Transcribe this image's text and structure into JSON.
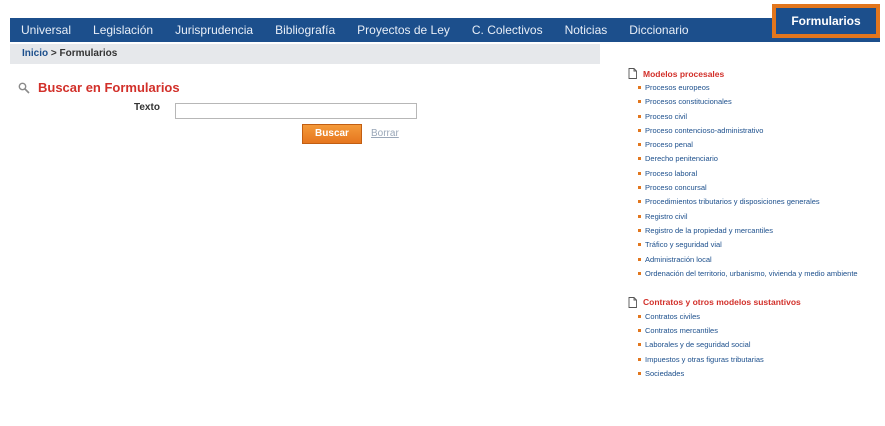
{
  "nav": {
    "items": [
      {
        "label": "Universal"
      },
      {
        "label": "Legislación"
      },
      {
        "label": "Jurisprudencia"
      },
      {
        "label": "Bibliografía"
      },
      {
        "label": "Proyectos de Ley"
      },
      {
        "label": "C. Colectivos"
      },
      {
        "label": "Noticias"
      },
      {
        "label": "Diccionario"
      }
    ],
    "active": "Formularios"
  },
  "breadcrumb": {
    "home": "Inicio",
    "separator": ">",
    "current": "Formularios"
  },
  "search": {
    "title": "Buscar en Formularios",
    "text_label": "Texto",
    "text_value": "",
    "submit_label": "Buscar",
    "clear_label": "Borrar"
  },
  "sections": [
    {
      "title": "Modelos procesales",
      "links": [
        "Procesos europeos",
        "Procesos constitucionales",
        "Proceso civil",
        "Proceso contencioso-administrativo",
        "Proceso penal",
        "Derecho penitenciario",
        "Proceso laboral",
        "Proceso concursal",
        "Procedimientos tributarios y disposiciones generales",
        "Registro civil",
        "Registro de la propiedad y mercantiles",
        "Tráfico y seguridad vial",
        "Administración local",
        "Ordenación del territorio, urbanismo, vivienda y medio ambiente"
      ]
    },
    {
      "title": "Contratos y otros modelos sustantivos",
      "links": [
        "Contratos civiles",
        "Contratos mercantiles",
        "Laborales y de seguridad social",
        "Impuestos y otras figuras tributarias",
        "Sociedades"
      ]
    }
  ],
  "colors": {
    "nav_bg": "#1c4f8c",
    "accent_orange": "#e2761d",
    "title_red": "#d2302a",
    "link_blue": "#1c4f8c"
  }
}
